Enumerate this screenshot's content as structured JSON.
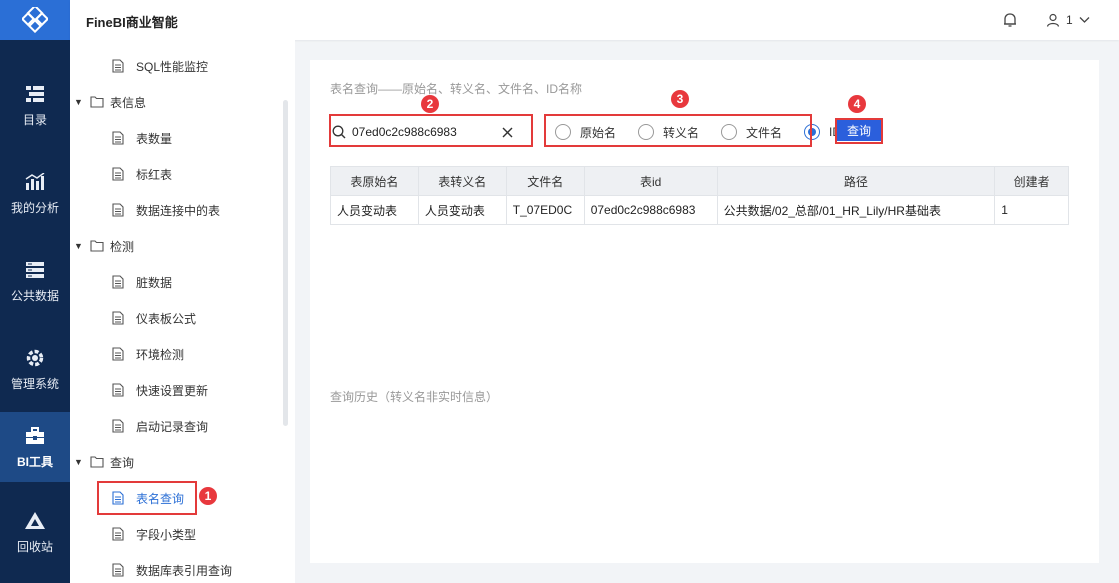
{
  "app": {
    "title": "FineBI商业智能"
  },
  "user": {
    "name": "1"
  },
  "rail": {
    "items": [
      {
        "label": "目录",
        "icon": "directory-icon"
      },
      {
        "label": "我的分析",
        "icon": "analysis-icon"
      },
      {
        "label": "公共数据",
        "icon": "database-icon"
      },
      {
        "label": "管理系统",
        "icon": "gear-icon"
      },
      {
        "label": "BI工具",
        "icon": "toolbox-icon"
      },
      {
        "label": "回收站",
        "icon": "recycle-icon"
      }
    ],
    "active": "BI工具"
  },
  "tree": {
    "items": [
      {
        "label": "SQL性能监控",
        "kind": "doc"
      },
      {
        "label": "表信息",
        "kind": "folder"
      },
      {
        "label": "表数量",
        "kind": "doc"
      },
      {
        "label": "标红表",
        "kind": "doc"
      },
      {
        "label": "数据连接中的表",
        "kind": "doc"
      },
      {
        "label": "检测",
        "kind": "folder"
      },
      {
        "label": "脏数据",
        "kind": "doc"
      },
      {
        "label": "仪表板公式",
        "kind": "doc"
      },
      {
        "label": "环境检测",
        "kind": "doc"
      },
      {
        "label": "快速设置更新",
        "kind": "doc"
      },
      {
        "label": "启动记录查询",
        "kind": "doc"
      },
      {
        "label": "查询",
        "kind": "folder"
      },
      {
        "label": "表名查询",
        "kind": "doc"
      },
      {
        "label": "字段小类型",
        "kind": "doc"
      },
      {
        "label": "数据库表引用查询",
        "kind": "doc"
      }
    ]
  },
  "badges": {
    "b1": "1",
    "b2": "2",
    "b3": "3",
    "b4": "4"
  },
  "main": {
    "title": "表名查询——原始名、转义名、文件名、ID名称",
    "search_value": "07ed0c2c988c6983",
    "radios": {
      "r1": "原始名",
      "r2": "转义名",
      "r3": "文件名",
      "r4": "ID"
    },
    "selected_radio": "ID",
    "query_label": "查询",
    "table": {
      "headers": {
        "h1": "表原始名",
        "h2": "表转义名",
        "h3": "文件名",
        "h4": "表id",
        "h5": "路径",
        "h6": "创建者"
      },
      "row": {
        "c1": "人员变动表",
        "c2": "人员变动表",
        "c3": "T_07ED0C",
        "c4": "07ed0c2c988c6983",
        "c5": "公共数据/02_总部/01_HR_Lily/HR基础表",
        "c6": "1"
      }
    },
    "history_label": "查询历史（转义名非实时信息）"
  },
  "colors": {
    "rail_bg": "#0f2950",
    "accent": "#2b6fd6",
    "highlight": "#e33a3a"
  }
}
